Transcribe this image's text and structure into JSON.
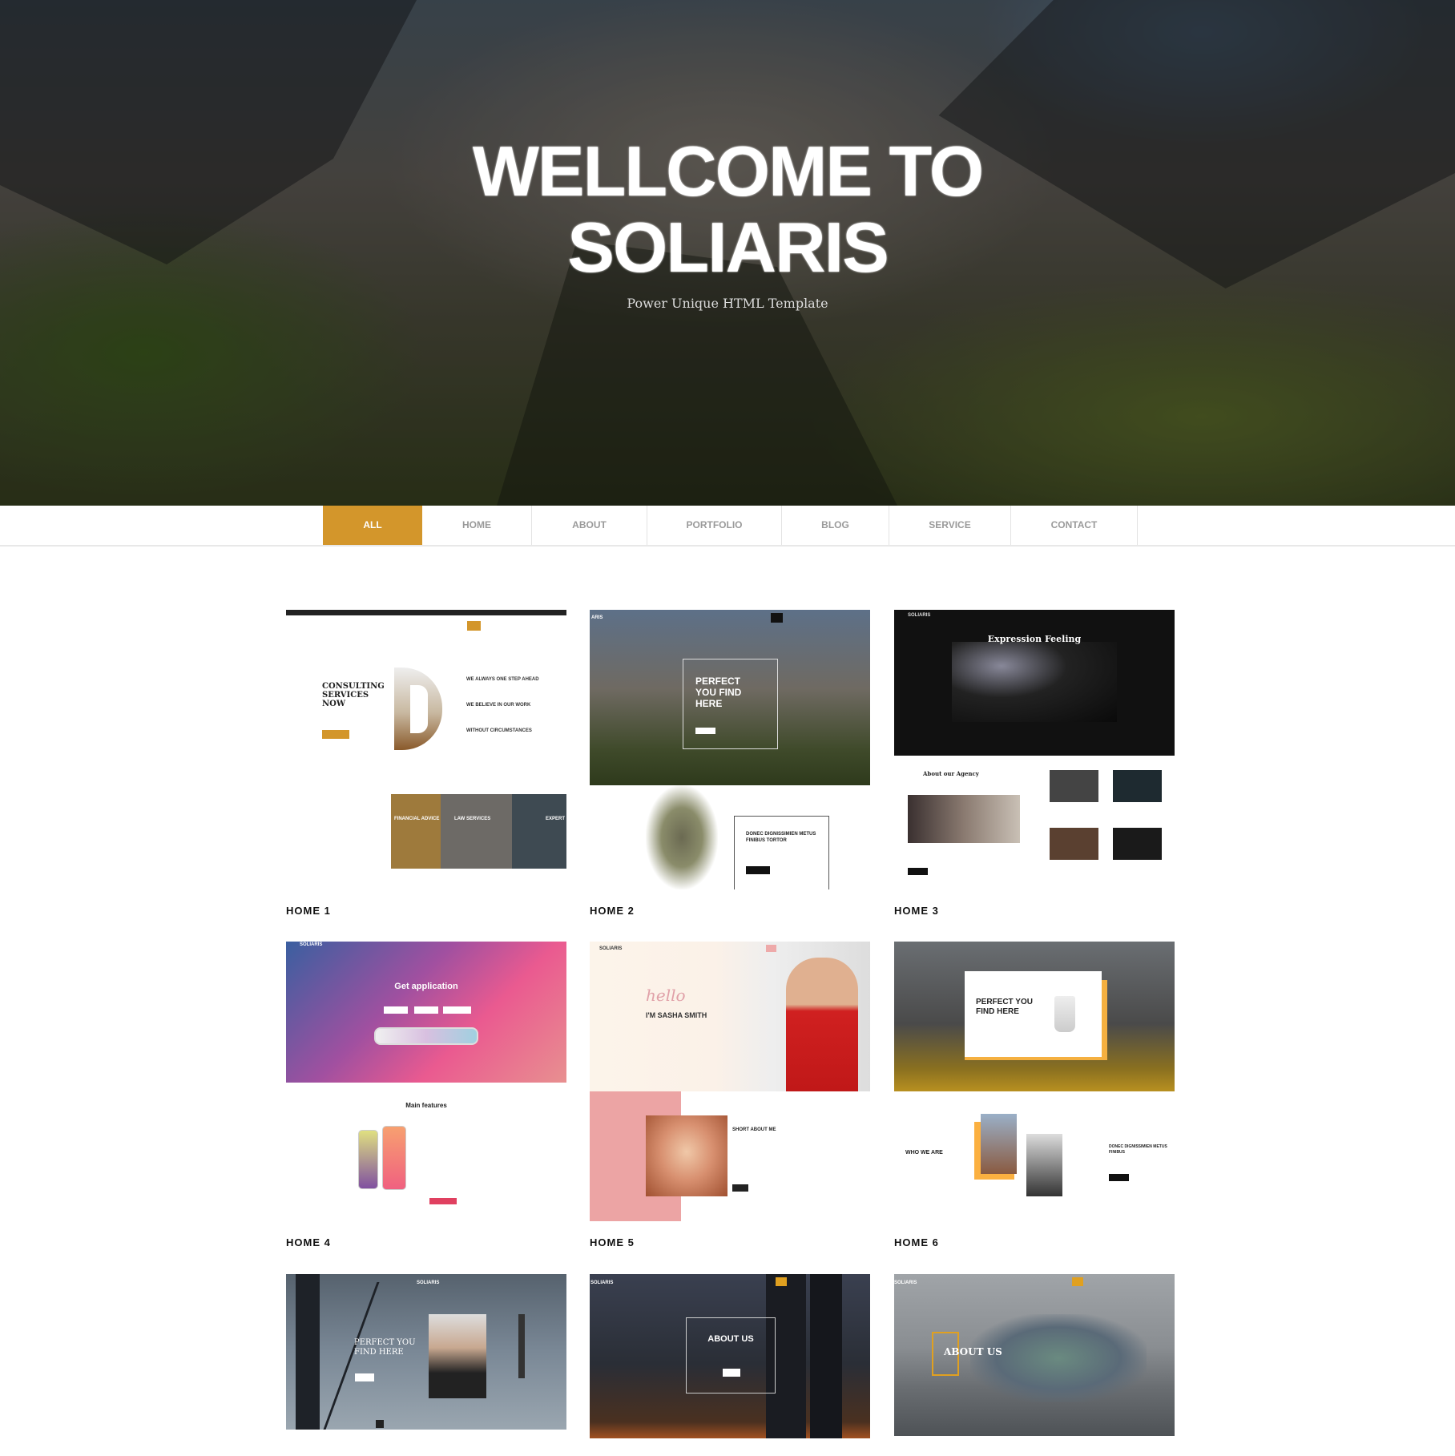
{
  "hero": {
    "title_line1": "WELLCOME TO",
    "title_line2": "SOLIARIS",
    "subtitle": "Power Unique HTML Template"
  },
  "nav": {
    "items": [
      {
        "label": "ALL",
        "active": true
      },
      {
        "label": "HOME"
      },
      {
        "label": "ABOUT"
      },
      {
        "label": "PORTFOLIO"
      },
      {
        "label": "BLOG"
      },
      {
        "label": "SERVICE"
      },
      {
        "label": "CONTACT"
      }
    ]
  },
  "colors": {
    "accent": "#d3962b",
    "nav_text": "#9a9a9a"
  },
  "demos": [
    {
      "label": "HOME 1",
      "heading": "CONSULTING SERVICES NOW",
      "features": [
        "WE ALWAYS ONE STEP AHEAD",
        "WE BELIEVE IN OUR WORK",
        "WITHOUT CIRCUMSTANCES"
      ],
      "panels": [
        "FINANCIAL ADVICE",
        "LAW SERVICES",
        "EXPERT"
      ]
    },
    {
      "label": "HOME 2",
      "brand": "ARIS",
      "heading": "PERFECT YOU FIND HERE",
      "subheading": "DONEC DIGNISSIMIEN METUS FINIBUS TORTOR"
    },
    {
      "label": "HOME 3",
      "brand": "SOLIARIS",
      "heading": "Expression Feeling",
      "subheading": "About our Agency"
    },
    {
      "label": "HOME 4",
      "brand": "SOLIARIS",
      "heading": "Get application",
      "subheading": "Main features"
    },
    {
      "label": "HOME 5",
      "brand": "SOLIARIS",
      "script": "hello",
      "heading": "I'M SASHA SMITH",
      "subheading": "SHORT ABOUT ME"
    },
    {
      "label": "HOME 6",
      "heading": "PERFECT YOU FIND HERE",
      "subheading": "WHO WE ARE",
      "side": "DONEC DIGNISSIMIEN METUS FINIBUS"
    },
    {
      "brand": "SOLIARIS",
      "heading": "PERFECT YOU FIND HERE"
    },
    {
      "brand": "SOLIARIS",
      "heading": "ABOUT US"
    },
    {
      "brand": "SOLIARIS",
      "heading": "ABOUT US"
    }
  ]
}
